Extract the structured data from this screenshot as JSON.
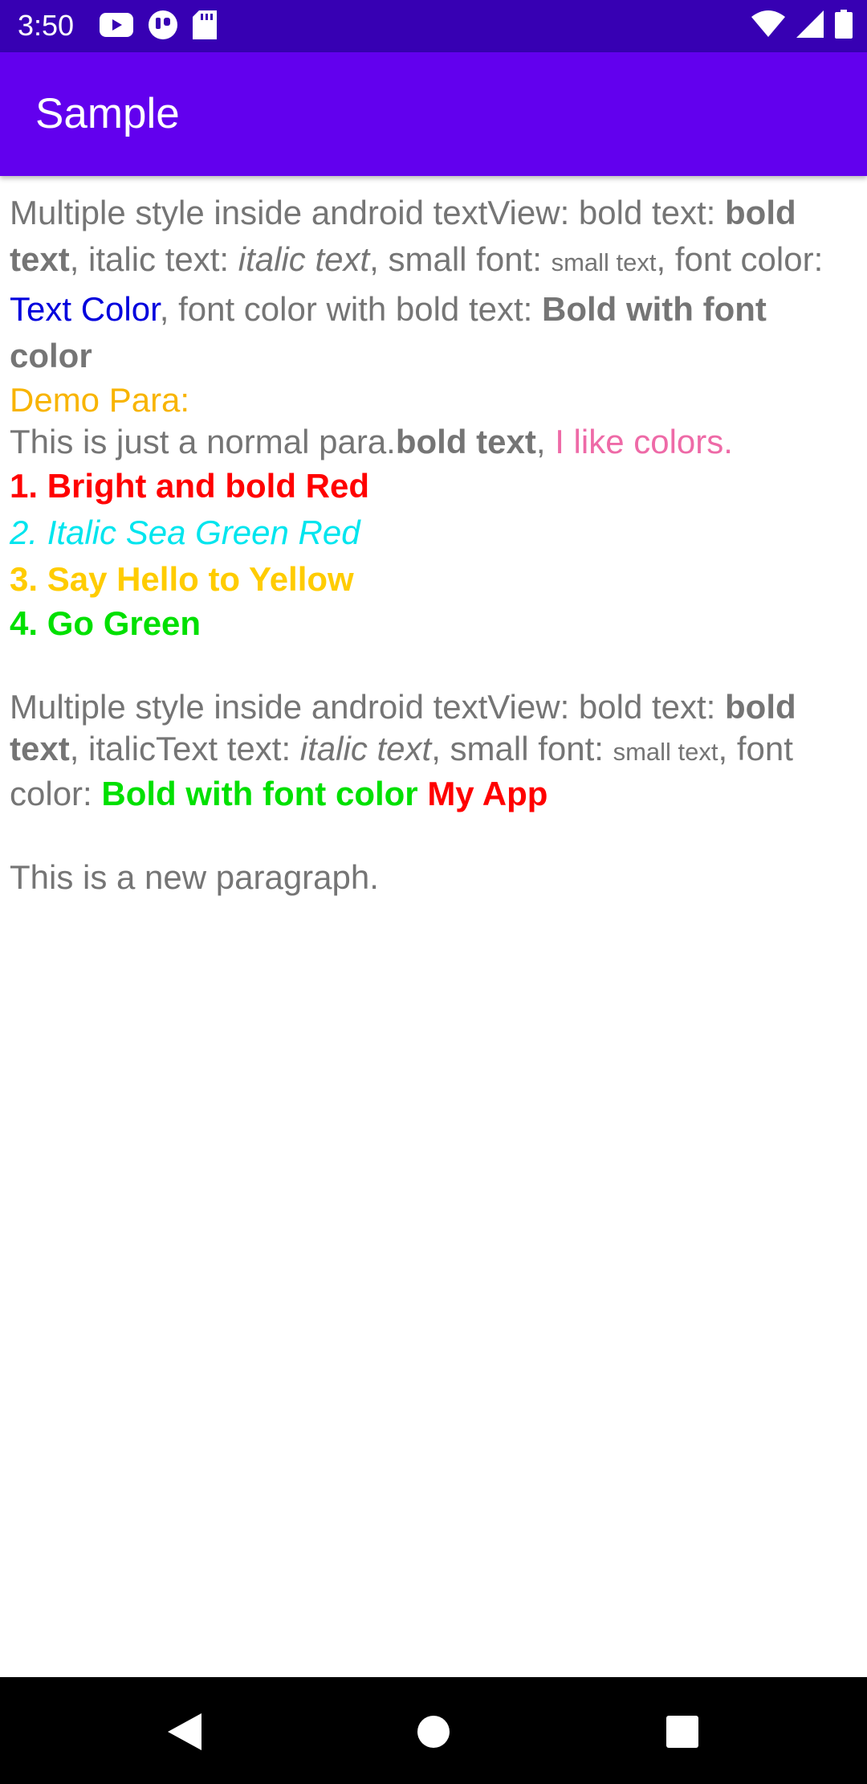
{
  "status_bar": {
    "time": "3:50",
    "left_icons": [
      "youtube-icon",
      "app-notification-icon",
      "sd-card-icon"
    ],
    "right_icons": [
      "wifi-icon",
      "signal-icon",
      "battery-icon"
    ]
  },
  "app_bar": {
    "title": "Sample"
  },
  "content": {
    "para1": {
      "t1": "Multiple style inside android textView: bold text: ",
      "bold": "bold text",
      "t2": ", italic text: ",
      "italic": "italic text",
      "t3": ", small font: ",
      "small": "small text",
      "t4": ", font color: ",
      "color": "Text Color",
      "t5": ", font color with bold text: ",
      "bold_color": "Bold with font color"
    },
    "demo_heading": "Demo Para:",
    "demo_para": {
      "t1": "This is just a normal para.",
      "bold": "bold text",
      "t2": ", ",
      "colored": "I like colors."
    },
    "list": [
      "1. Bright and bold Red",
      "2. Italic Sea Green Red",
      "3. Say Hello to Yellow",
      "4. Go Green"
    ],
    "para2": {
      "t1": "Multiple style inside android textView: bold text: ",
      "bold": "bold text",
      "t2": ", italicText text: ",
      "italic": "italic text",
      "t3": ", small font: ",
      "small": "small text",
      "t4": ", font color: ",
      "green_bold": "Bold with font color",
      "t5": " ",
      "red_bold": "My App"
    },
    "para3": "This is a new paragraph."
  },
  "colors": {
    "status_bar": "#3700b3",
    "app_bar": "#6200ee",
    "body_text": "#757575",
    "blue": "#0000dd",
    "orange": "#f8b400",
    "pink": "#ee6aa7",
    "red": "#ff0000",
    "cyan": "#00e5ee",
    "yellow": "#ffcc00",
    "green": "#00e000"
  },
  "nav_bar": {
    "buttons": [
      "back-icon",
      "home-icon",
      "recents-icon"
    ]
  }
}
